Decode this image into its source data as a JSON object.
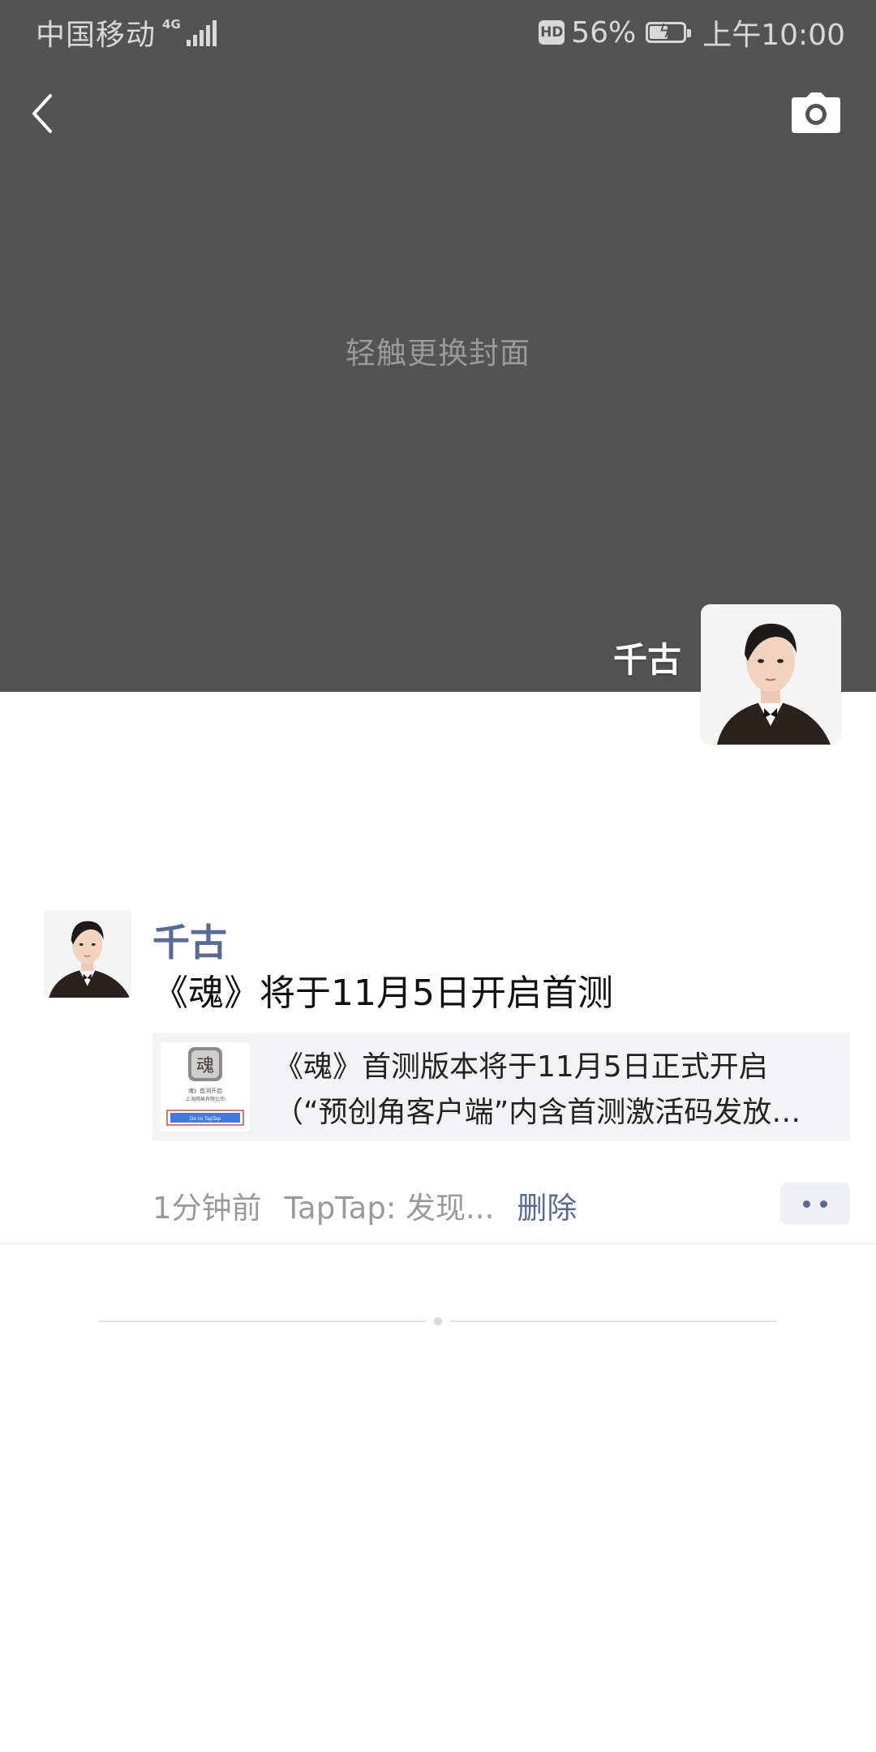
{
  "status_bar": {
    "carrier": "中国移动",
    "network": "4G",
    "hd": "HD",
    "battery": "56%",
    "battery_level": 0.56,
    "time": "上午10:00"
  },
  "icons": {
    "back": "chevron-left-icon",
    "camera": "camera-icon",
    "more": "more-dots-icon",
    "battery": "battery-charging-icon",
    "signal": "signal-icon"
  },
  "colors": {
    "cover_bg": "#535353",
    "link_blue": "#576b95",
    "card_bg": "#f3f3f5"
  },
  "cover": {
    "hint": "轻触更换封面",
    "user_name": "千古"
  },
  "moment": {
    "author": "千古",
    "text": "《魂》将于11月5日开启首测",
    "link_card": {
      "title": "《魂》首测版本将于11月5日正式开启",
      "subtitle": "（“预创角客户端”内含首测激活码发放…",
      "thumb_caption": "魂》首测开启",
      "thumb_company": "上海网易有限公司",
      "thumb_button": "Go to TapTap"
    },
    "time": "1分钟前",
    "source": "TapTap: 发现...",
    "delete": "删除"
  }
}
